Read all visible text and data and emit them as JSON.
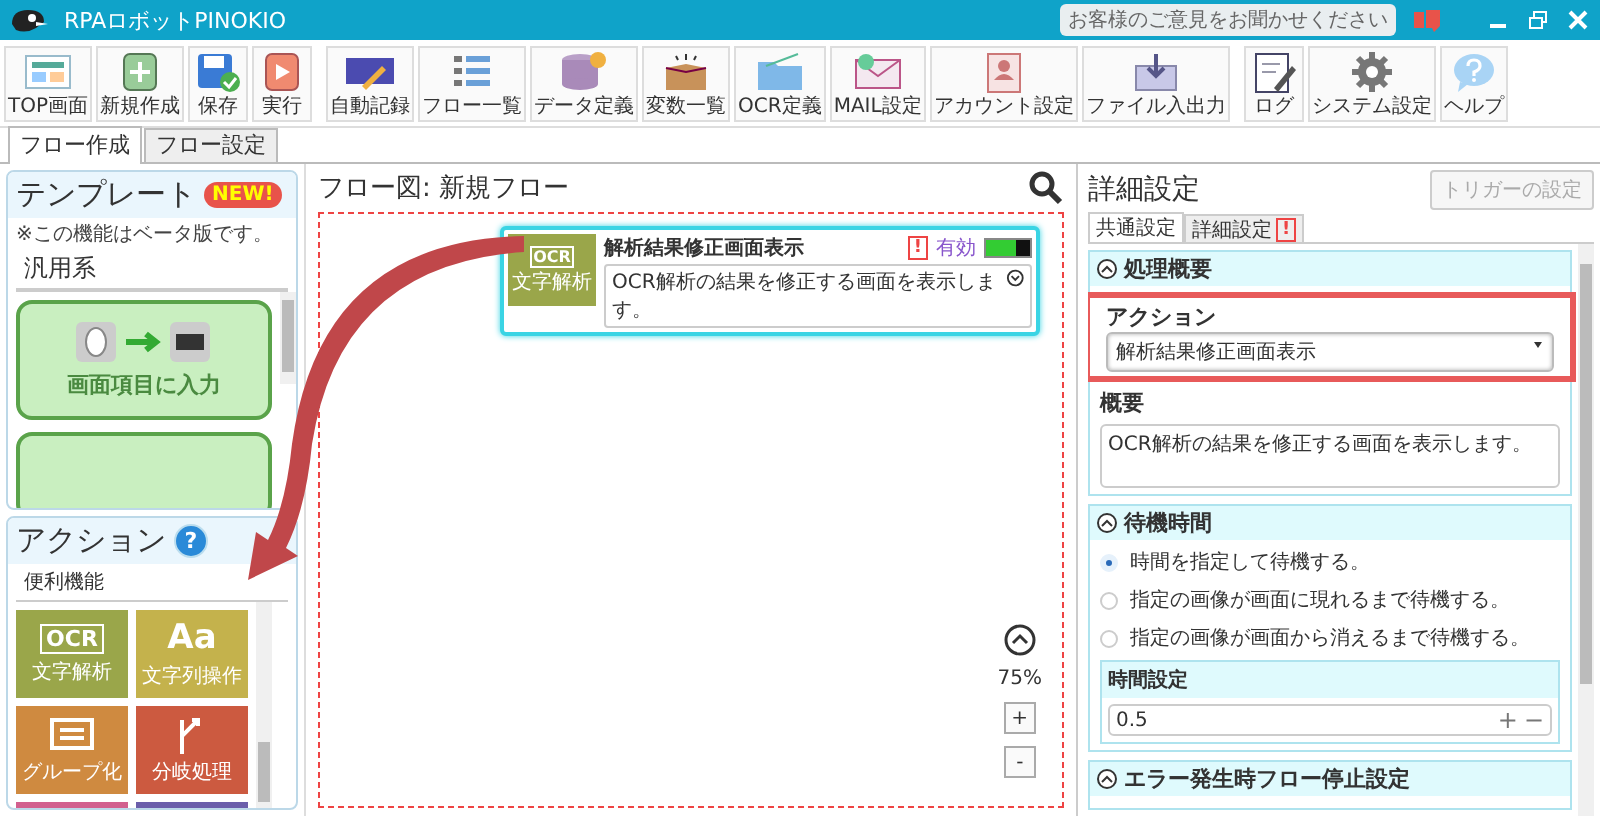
{
  "window": {
    "title": "RPAロボットPINOKIO",
    "feedback": "お客様のご意見をお聞かせください"
  },
  "toolbar": [
    [
      {
        "label": "TOP画面",
        "kind": "top"
      },
      {
        "label": "新規作成",
        "kind": "new"
      },
      {
        "label": "保存",
        "kind": "save"
      },
      {
        "label": "実行",
        "kind": "run"
      }
    ],
    [
      {
        "label": "自動記録",
        "kind": "record"
      },
      {
        "label": "フロー一覧",
        "kind": "list"
      },
      {
        "label": "データ定義",
        "kind": "data"
      },
      {
        "label": "変数一覧",
        "kind": "box"
      },
      {
        "label": "OCR定義",
        "kind": "folder"
      },
      {
        "label": "MAIL設定",
        "kind": "mail"
      },
      {
        "label": "アカウント設定",
        "kind": "account"
      },
      {
        "label": "ファイル入出力",
        "kind": "file"
      }
    ],
    [
      {
        "label": "ログ",
        "kind": "log"
      },
      {
        "label": "システム設定",
        "kind": "gear"
      },
      {
        "label": "ヘルプ",
        "kind": "help"
      }
    ]
  ],
  "tabs": [
    {
      "label": "フロー作成",
      "selected": true
    },
    {
      "label": "フロー設定",
      "selected": false
    }
  ],
  "templates": {
    "title": "テンプレート",
    "badge": "NEW!",
    "note": "※この機能はベータ版です。",
    "category": "汎用系",
    "items": [
      "画面項目に入力"
    ]
  },
  "actions": {
    "title": "アクション",
    "help": "?",
    "category": "便利機能",
    "tiles": [
      {
        "label": "文字解析",
        "kind": "ocr",
        "glyph": "OCR",
        "color": "#9aa64a"
      },
      {
        "label": "文字列操作",
        "kind": "text",
        "glyph": "Aa",
        "color": "#c4b24c"
      },
      {
        "label": "グループ化",
        "kind": "group",
        "color": "#cf8a40"
      },
      {
        "label": "分岐処理",
        "kind": "branch",
        "color": "#cc5a40"
      },
      {
        "kind": "loop",
        "color": "#d2608e"
      },
      {
        "kind": "window",
        "color": "#6b5eaa"
      }
    ]
  },
  "flow": {
    "title": "フロー図:  新規フロー",
    "node": {
      "title": "解析結果修正画面表示",
      "glyph": "OCR",
      "icon_label": "文字解析",
      "warning": "!",
      "status": "有効",
      "enabled": true,
      "description": "OCR解析の結果を修正する画面を表示します。"
    },
    "zoom": "75%",
    "zoom_buttons": [
      "+",
      "-"
    ]
  },
  "details": {
    "title": "詳細設定",
    "trigger_button": {
      "label": "トリガーの設定",
      "disabled": true
    },
    "tabs": [
      {
        "label": "共通設定",
        "selected": true
      },
      {
        "label": "詳細設定",
        "selected": false,
        "warning": "!"
      }
    ],
    "summary": {
      "title": "処理概要",
      "expanded": true,
      "action_label": "アクション",
      "action_value": "解析結果修正画面表示",
      "overview_label": "概要",
      "overview_value": "OCR解析の結果を修正する画面を表示します。"
    },
    "wait": {
      "title": "待機時間",
      "expanded": true,
      "options": [
        {
          "label": "時間を指定して待機する。",
          "selected": true
        },
        {
          "label": "指定の画像が画面に現れるまで待機する。",
          "selected": false
        },
        {
          "label": "指定の画像が画面から消えるまで待機する。",
          "selected": false
        }
      ],
      "time_label": "時間設定",
      "time_value": "0.5",
      "stepper": [
        "+",
        "−"
      ]
    },
    "error": {
      "title": "エラー発生時フロー停止設定",
      "expanded": true
    }
  }
}
